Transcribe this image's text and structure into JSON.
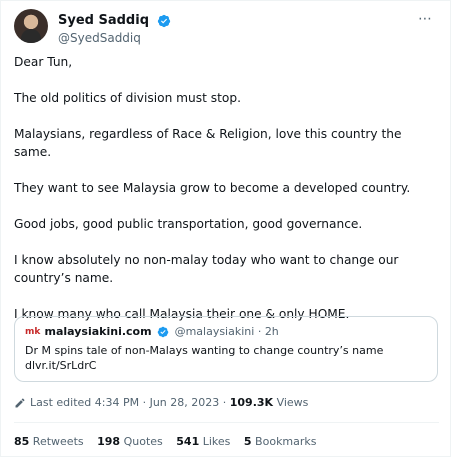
{
  "author": {
    "display_name": "Syed Saddiq",
    "handle": "@SyedSaddiq"
  },
  "more_icon": "⋯",
  "tweet": {
    "paragraphs": [
      "Dear Tun,",
      "The old politics of division must stop.",
      "Malaysians, regardless of Race & Religion, love this country the same.",
      "They want to see Malaysia grow to become a developed country.",
      "Good jobs, good public transportation, good governance.",
      "I know absolutely no non-malay today who want to change our country’s name.",
      "I know many who call Malaysia their one & only HOME."
    ]
  },
  "quote": {
    "logo_text": "mk",
    "name": "malaysiakini.com",
    "handle": "@malaysiakini",
    "separator": "·",
    "time": "2h",
    "text": "Dr M spins tale of non-Malays wanting to change country’s name",
    "link": "dlvr.it/SrLdrC"
  },
  "meta": {
    "edited": "Last edited 4:34 PM · Jun 28, 2023 · ",
    "views_count": "109.3K",
    "views_label": " Views"
  },
  "stats": {
    "retweets_count": "85",
    "retweets_label": " Retweets",
    "quotes_count": "198",
    "quotes_label": " Quotes",
    "likes_count": "541",
    "likes_label": " Likes",
    "bookmarks_count": "5",
    "bookmarks_label": " Bookmarks"
  },
  "colors": {
    "verified": "#1d9bf0",
    "text": "#0f1419",
    "secondary": "#536471",
    "border": "#cfd9de",
    "brand_red": "#c62828"
  }
}
